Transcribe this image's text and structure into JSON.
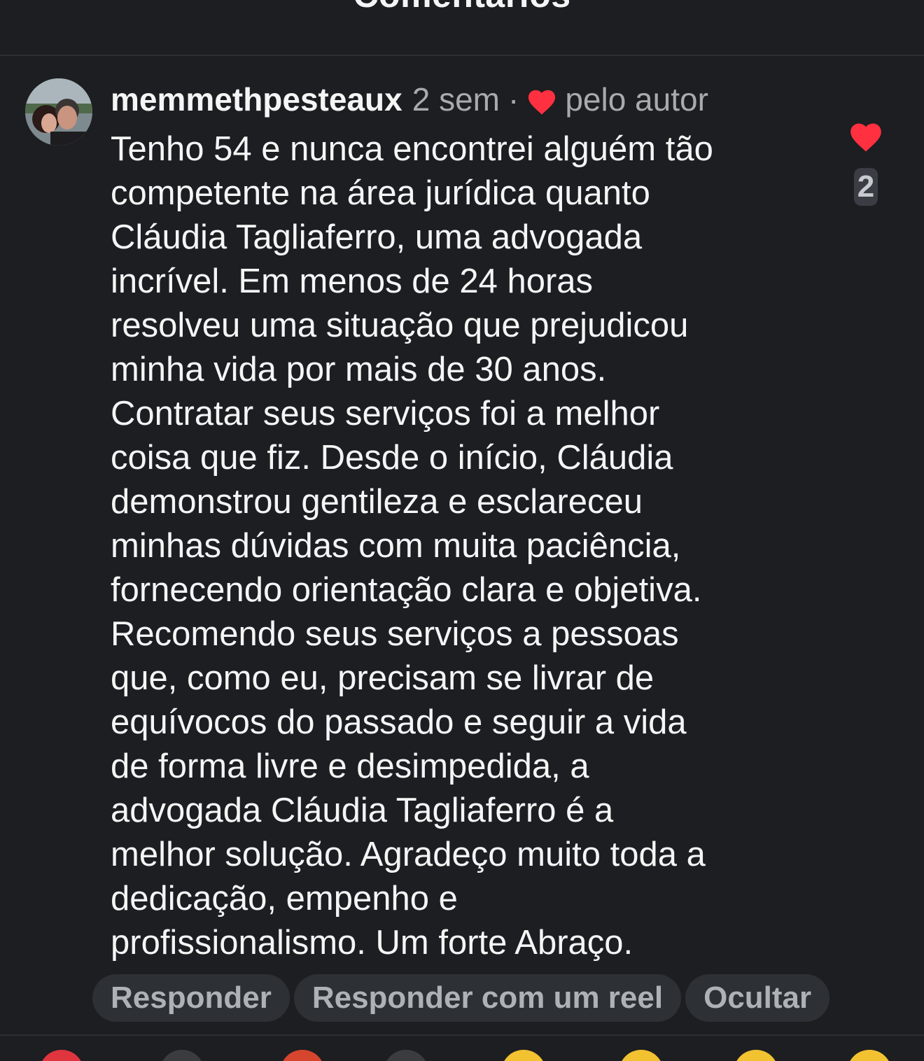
{
  "sheet": {
    "title": "Comentários"
  },
  "comment": {
    "username": "memmethpesteaux",
    "time": "2 sem",
    "separator": "·",
    "author_liked_label": "pelo autor",
    "text": "Tenho 54 e nunca encontrei alguém tão\ncompetente na área jurídica quanto\nCláudia Tagliaferro, uma advogada\nincrível. Em menos de 24 horas\nresolveu uma situação que prejudicou\nminha vida por mais de 30 anos.\nContratar seus serviços foi a melhor\ncoisa que fiz. Desde o início, Cláudia\ndemonstrou gentileza e esclareceu\nminhas dúvidas com muita paciência,\nfornecendo orientação clara e objetiva.\nRecomendo seus serviços a pessoas\nque, como eu, precisam se livrar de\nequívocos do passado e seguir a vida\nde forma livre e desimpedida, a\nadvogada Cláudia Tagliaferro é a\nmelhor solução. Agradeço muito toda a\ndedicação, empenho e\nprofissionalismo. Um forte Abraço.",
    "like_count": "2"
  },
  "actions": {
    "reply_label": "Responder",
    "reply_reel_label": "Responder com um reel",
    "hide_label": "Ocultar"
  },
  "icons": {
    "avatar": "user-avatar",
    "author_heart": "heart-icon",
    "like": "heart-icon"
  },
  "colors": {
    "background": "#1c1e21",
    "heart": "#ff3040",
    "muted_text": "#a7abb0",
    "pill_bg": "#2d3034"
  }
}
